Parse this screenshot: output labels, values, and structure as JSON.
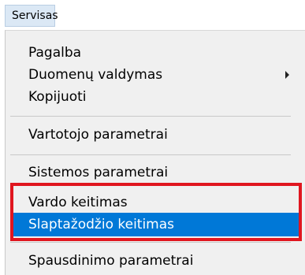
{
  "menubar": {
    "title": "Servisas"
  },
  "menu": {
    "items": [
      {
        "label": "Pagalba"
      },
      {
        "label": "Duomenų valdymas",
        "has_submenu": true
      },
      {
        "label": "Kopijuoti"
      },
      {
        "label": "Vartotojo parametrai"
      },
      {
        "label": "Sistemos parametrai"
      },
      {
        "label": "Vardo keitimas"
      },
      {
        "label": "Slaptažodžio keitimas",
        "selected": true
      },
      {
        "label": "Spausdinimo parametrai"
      }
    ]
  },
  "colors": {
    "selection": "#0078d7",
    "highlight_box": "#e0161f",
    "menu_background": "#f0f0f0"
  }
}
